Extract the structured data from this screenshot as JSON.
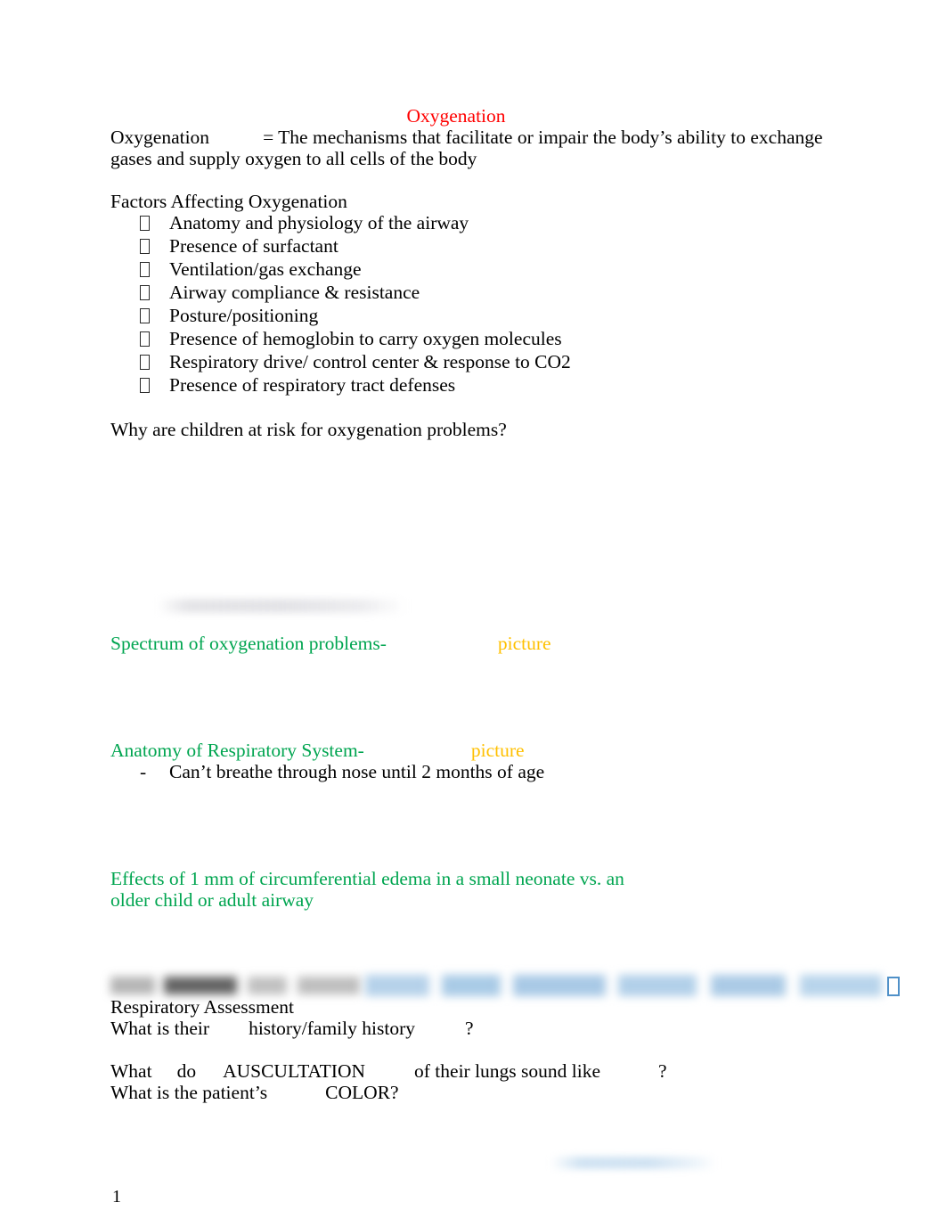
{
  "document": {
    "title": "Oxygenation",
    "page_number": "1",
    "colors": {
      "title_red": "#ff0000",
      "heading_green": "#00a550",
      "picture_amber": "#ffc000",
      "redacted_blue": "#4f90c8",
      "body_black": "#000000"
    },
    "definition": {
      "term": "Oxygenation",
      "gap": "",
      "text": "= The mechanisms that facilitate or impair the body’s ability to exchange gases and supply oxygen to all cells of the body"
    },
    "factors": {
      "heading": "Factors Affecting Oxygenation",
      "bullet_glyph": "missing-glyph-box",
      "items": [
        "Anatomy and physiology of the airway",
        "Presence of surfactant",
        "Ventilation/gas exchange",
        "Airway compliance & resistance",
        "Posture/positioning",
        "Presence of hemoglobin to carry oxygen molecules",
        "Respiratory drive/ control center & response to CO2",
        "Presence of respiratory tract defenses"
      ]
    },
    "question_children": "Why are children at risk for oxygenation problems?",
    "spectrum": {
      "heading": "Spectrum of oxygenation problems-",
      "picture_label": "picture"
    },
    "anatomy": {
      "heading": "Anatomy of Respiratory System-",
      "picture_label": "picture",
      "dash_glyph": "-",
      "sub_item": "Can’t breathe through nose until 2 months of age"
    },
    "edema": {
      "line1": "Effects of 1 mm of circumferential edema in a small neonate vs. an",
      "line2": "older child or adult airway"
    },
    "assessment": {
      "heading": "Respiratory Assessment",
      "history_line": {
        "part1": "What is their",
        "part2": "history/family history",
        "part3": "?"
      },
      "redacted_line": {
        "note": "blurred-redacted-text",
        "trailing_glyph": "missing-glyph-box"
      },
      "auscultation_line": {
        "part1": "What",
        "part2": "do",
        "part3": "AUSCULTATION",
        "part4": "of their lungs sound like",
        "part5": "?"
      },
      "color_line": {
        "part1": "What is the patient’s",
        "part2": "COLOR?"
      }
    }
  }
}
